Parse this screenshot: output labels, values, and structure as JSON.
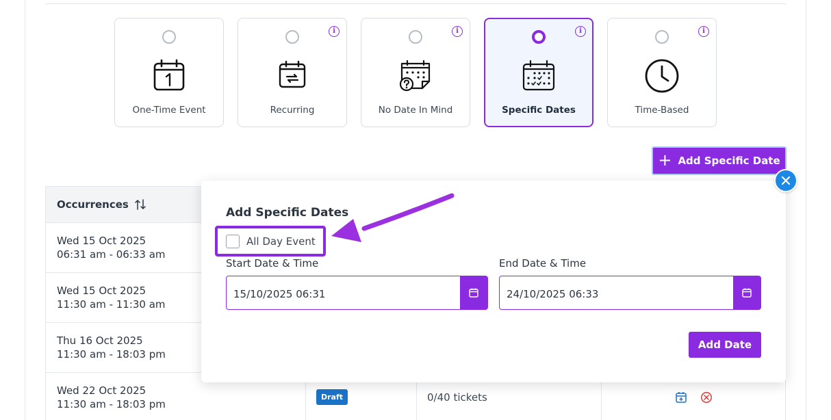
{
  "event_types": [
    {
      "label": "One-Time Event",
      "icon": "calendar-one-icon",
      "info": false,
      "selected": false
    },
    {
      "label": "Recurring",
      "icon": "recurring-calendar-icon",
      "info": true,
      "selected": false
    },
    {
      "label": "No Date In Mind",
      "icon": "calendar-question-icon",
      "info": true,
      "selected": false
    },
    {
      "label": "Specific Dates",
      "icon": "calendar-grid-icon",
      "info": true,
      "selected": true
    },
    {
      "label": "Time-Based",
      "icon": "clock-icon",
      "info": true,
      "selected": false
    }
  ],
  "info_glyph": "i",
  "add_specific_date_label": "Add Specific Date",
  "plus_glyph": "+",
  "table": {
    "header": "Occurrences",
    "rows": [
      {
        "date": "Wed 15 Oct 2025",
        "time": "06:31 am - 06:33 am"
      },
      {
        "date": "Wed 15 Oct 2025",
        "time": "11:30 am - 11:30 am"
      },
      {
        "date": "Thu 16 Oct 2025",
        "time": "11:30 am - 18:03 pm"
      },
      {
        "date": "Wed 22 Oct 2025",
        "time": "11:30 am - 18:03 pm",
        "status": "Draft",
        "tickets": "0/40 tickets"
      }
    ]
  },
  "popover": {
    "title": "Add Specific Dates",
    "all_day_label": "All Day Event",
    "start_label": "Start Date & Time",
    "start_value": "15/10/2025 06:31",
    "end_label": "End Date & Time",
    "end_value": "24/10/2025 06:33",
    "add_button": "Add Date"
  },
  "colors": {
    "accent": "#8a2be2",
    "close_blue": "#1e88e5",
    "draft_badge": "#1a73c7",
    "delete_red": "#e53935"
  }
}
